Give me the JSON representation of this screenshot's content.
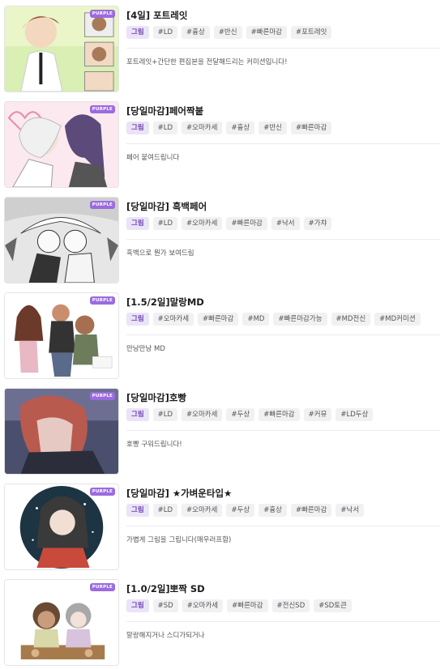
{
  "badge_label": "PURPLE",
  "colors": {
    "badge": "#9b6bdf",
    "primary_tag_bg": "#ebe3f7",
    "primary_tag_text": "#6a3fb0",
    "tag_bg": "#f1f1f3"
  },
  "items": [
    {
      "title": "[4일] 포트레잇",
      "primary_tag": "그림",
      "tags": [
        "#LD",
        "#흉상",
        "#반신",
        "#빠른마감",
        "#포트레잇"
      ],
      "description": "포트레잇+간단한 편집본을 전달해드리는 커미션입니다!"
    },
    {
      "title": "[당일마감]페어짝붙",
      "primary_tag": "그림",
      "tags": [
        "#LD",
        "#오마카세",
        "#흉상",
        "#반신",
        "#빠른마감"
      ],
      "description": "페어 붙여드립니다"
    },
    {
      "title": "[당일마감] 흑백페어",
      "primary_tag": "그림",
      "tags": [
        "#LD",
        "#오마카세",
        "#빠른마감",
        "#낙서",
        "#가챠"
      ],
      "description": "흑백으로 뭔가 보여드림"
    },
    {
      "title": "[1.5/2일]말랑MD",
      "primary_tag": "그림",
      "tags": [
        "#오마카세",
        "#빠른마감",
        "#MD",
        "#빠른마감가능",
        "#MD전신",
        "#MD커미션"
      ],
      "description": "만낭만낭 MD"
    },
    {
      "title": "[당일마감]호빵",
      "primary_tag": "그림",
      "tags": [
        "#LD",
        "#오마카세",
        "#두상",
        "#빠른마감",
        "#커뮤",
        "#LD두상"
      ],
      "description": "호빵 구워드립니다!"
    },
    {
      "title": "[당일마감] ★가벼운타입★",
      "primary_tag": "그림",
      "tags": [
        "#LD",
        "#오마카세",
        "#두상",
        "#흉상",
        "#빠른마감",
        "#낙서"
      ],
      "description": "가볍게 그림을 그립니다(매우러프함)"
    },
    {
      "title": "[1.0/2일]뽀짝 SD",
      "primary_tag": "그림",
      "tags": [
        "#SD",
        "#오마카세",
        "#빠른마감",
        "#전신SD",
        "#SD토큰"
      ],
      "description": "말랑해지거나 스디가되거나"
    }
  ]
}
